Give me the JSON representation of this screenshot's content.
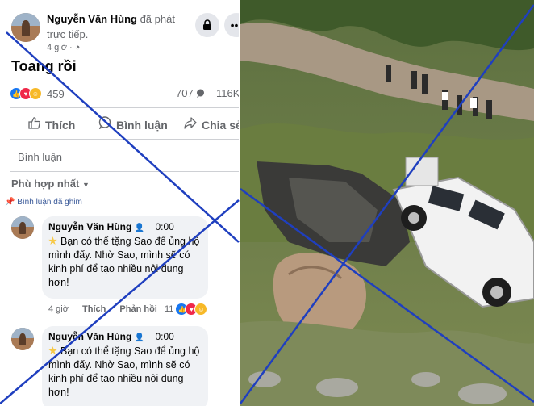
{
  "post": {
    "author": "Nguyễn Văn Hùng",
    "action_line1": "đã phát",
    "action_line2": "trực tiếp.",
    "time": "4 giờ · ◔",
    "text": "Toang rồi",
    "reaction_count": "459",
    "comment_count": "707",
    "share_count": "116K"
  },
  "actions": {
    "like": "Thích",
    "comment": "Bình luận",
    "share": "Chia sẻ"
  },
  "comments_section": {
    "input_placeholder": "Bình luận",
    "sort_label": "Phù hợp nhất",
    "pinned_label": "Bình luận đã ghim"
  },
  "comments": [
    {
      "author": "Nguyễn Văn Hùng",
      "time": "0:00",
      "text": "Bạn có thể tặng Sao để ủng hộ mình đấy. Nhờ Sao, mình sẽ có kinh phí để tạo nhiều nội dung hơn!",
      "age": "4 giờ",
      "like": "Thích",
      "reply": "Phản hồi",
      "reactions": "11"
    },
    {
      "author": "Nguyễn Văn Hùng",
      "time": "0:00",
      "text": "Bạn có thể tặng Sao để ủng hộ mình đấy. Nhờ Sao, mình sẽ có kinh phí để tạo nhiều nội dung hơn!"
    }
  ],
  "icons": {
    "avatar": "avatar",
    "messenger_button": "lock-icon",
    "more_button": "more-icon",
    "like_icon": "thumbs-up-icon",
    "comment_icon": "comment-icon",
    "share_icon": "share-icon",
    "pin_icon": "pin-icon",
    "sort_icon": "caret-down-icon"
  },
  "colors": {
    "cross_lines": "#1f3fbf",
    "like_blue": "#1877f2",
    "love_red": "#f02849",
    "haha_yellow": "#f7b928"
  }
}
